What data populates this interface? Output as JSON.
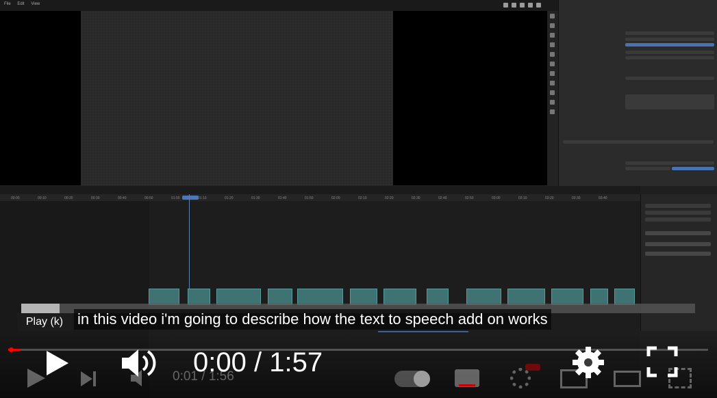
{
  "editor": {
    "menu": [
      "File",
      "Edit",
      "View"
    ],
    "ruler_ticks": [
      "00:00",
      "00:10",
      "00:20",
      "00:30",
      "00:40",
      "00:50",
      "01:00",
      "01:10",
      "01:20",
      "01:30",
      "01:40",
      "01:50",
      "02:00",
      "02:10",
      "02:20",
      "02:30",
      "02:40",
      "02:50",
      "03:00",
      "03:10",
      "03:20",
      "03:30",
      "03:40"
    ]
  },
  "player": {
    "caption": "in this video i'm going to describe how the text to speech add on works",
    "tooltip": "Play (k)",
    "time_current": "0:00",
    "time_separator": "/",
    "time_total": "1:57",
    "ghost_time": "0:01 / 1:56",
    "progress_fraction": 0.0
  }
}
